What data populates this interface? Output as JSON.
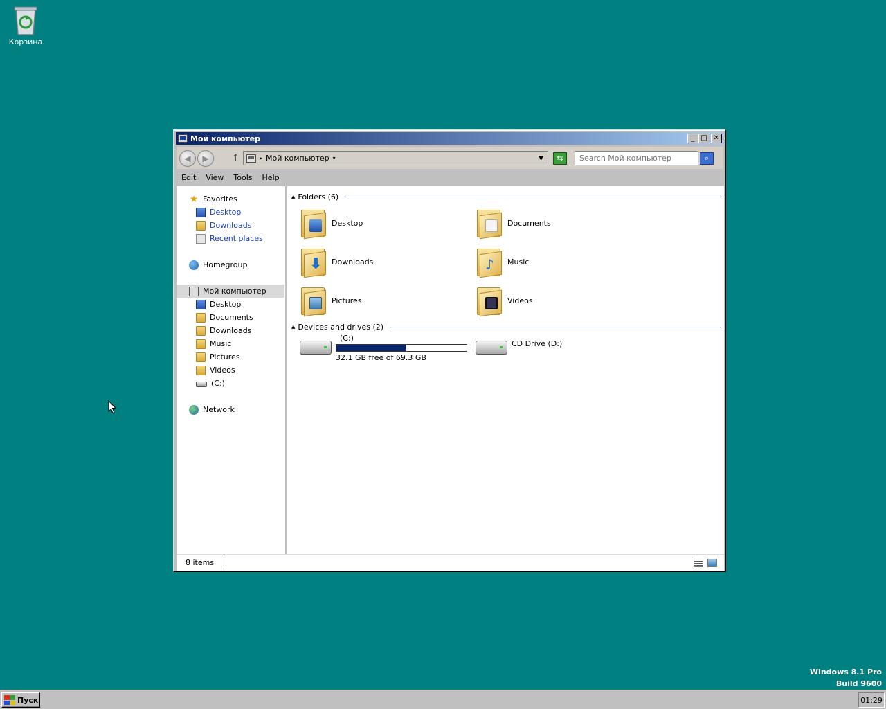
{
  "desktop": {
    "recycle_bin_label": "Корзина",
    "watermark_line1": "Windows 8.1 Pro",
    "watermark_line2": "Build 9600"
  },
  "taskbar": {
    "start_label": "Пуск",
    "clock": "01:29"
  },
  "window": {
    "title": "Мой компьютер",
    "minimize_glyph": "_",
    "maximize_glyph": "□",
    "close_glyph": "✕",
    "address_text": "Мой компьютер",
    "search_placeholder": "Search Мой компьютер"
  },
  "menu": [
    "Edit",
    "View",
    "Tools",
    "Help"
  ],
  "nav_pane": {
    "favorites": "Favorites",
    "favorites_items": [
      "Desktop",
      "Downloads",
      "Recent places"
    ],
    "homegroup": "Homegroup",
    "computer": "Мой компьютер",
    "computer_items": [
      "Desktop",
      "Documents",
      "Downloads",
      "Music",
      "Pictures",
      "Videos",
      "(C:)"
    ],
    "network": "Network"
  },
  "folders_group": {
    "header": "Folders (6)",
    "items": [
      "Desktop",
      "Documents",
      "Downloads",
      "Music",
      "Pictures",
      "Videos"
    ]
  },
  "drives_group": {
    "header": "Devices and drives (2)",
    "c_drive": {
      "label": "(C:)",
      "free_text": "32.1 GB free of 69.3 GB",
      "used_fraction": 0.537
    },
    "d_drive": {
      "label": "CD Drive (D:)"
    }
  },
  "status": {
    "items_count": "8 items"
  },
  "colors": {
    "desktop_bg": "#008080",
    "titlebar_start": "#0a246a",
    "titlebar_end": "#a6caf0",
    "link_blue": "#1a3fb0",
    "usage_bar": "#0a246a"
  }
}
